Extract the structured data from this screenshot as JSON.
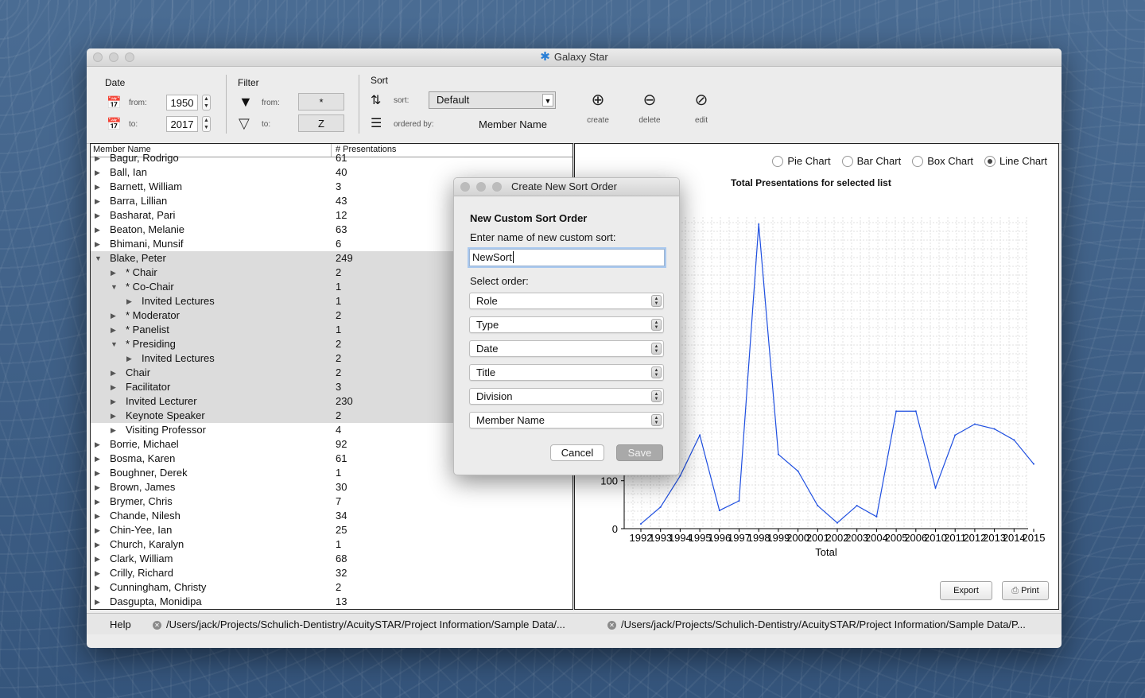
{
  "window": {
    "title": "Galaxy Star",
    "icon": "star-icon"
  },
  "toolbar": {
    "date": {
      "label": "Date",
      "from_label": "from:",
      "to_label": "to:",
      "from_value": "1950",
      "to_value": "2017"
    },
    "filter": {
      "label": "Filter",
      "from_label": "from:",
      "to_label": "to:",
      "from_value": "*",
      "to_value": "Z"
    },
    "sort": {
      "label": "Sort",
      "sort_label": "sort:",
      "sort_value": "Default",
      "ordered_label": "ordered by:",
      "ordered_value": "Member Name"
    },
    "actions": [
      {
        "label": "create",
        "icon": "⊕"
      },
      {
        "label": "delete",
        "icon": "⊖"
      },
      {
        "label": "edit",
        "icon": "⊘"
      }
    ]
  },
  "list": {
    "col_name": "Member Name",
    "col_count": "# Presentations",
    "rows": [
      {
        "name": "Bagur, Rodrigo",
        "count": "61",
        "level": 0,
        "expanded": false,
        "selected": false
      },
      {
        "name": "Ball, Ian",
        "count": "40",
        "level": 0,
        "expanded": false,
        "selected": false
      },
      {
        "name": "Barnett, William",
        "count": "3",
        "level": 0,
        "expanded": false,
        "selected": false
      },
      {
        "name": "Barra, Lillian",
        "count": "43",
        "level": 0,
        "expanded": false,
        "selected": false
      },
      {
        "name": "Basharat, Pari",
        "count": "12",
        "level": 0,
        "expanded": false,
        "selected": false
      },
      {
        "name": "Beaton, Melanie",
        "count": "63",
        "level": 0,
        "expanded": false,
        "selected": false
      },
      {
        "name": "Bhimani, Munsif",
        "count": "6",
        "level": 0,
        "expanded": false,
        "selected": false
      },
      {
        "name": "Blake, Peter",
        "count": "249",
        "level": 0,
        "expanded": true,
        "selected": true
      },
      {
        "name": "* Chair",
        "count": "2",
        "level": 1,
        "expanded": false,
        "selected": true
      },
      {
        "name": "* Co-Chair",
        "count": "1",
        "level": 1,
        "expanded": true,
        "selected": true
      },
      {
        "name": "Invited Lectures",
        "count": "1",
        "level": 2,
        "expanded": false,
        "selected": true
      },
      {
        "name": "* Moderator",
        "count": "2",
        "level": 1,
        "expanded": false,
        "selected": true
      },
      {
        "name": "* Panelist",
        "count": "1",
        "level": 1,
        "expanded": false,
        "selected": true
      },
      {
        "name": "* Presiding",
        "count": "2",
        "level": 1,
        "expanded": true,
        "selected": true
      },
      {
        "name": "Invited Lectures",
        "count": "2",
        "level": 2,
        "expanded": false,
        "selected": true
      },
      {
        "name": "Chair",
        "count": "2",
        "level": 1,
        "expanded": false,
        "selected": true
      },
      {
        "name": "Facilitator",
        "count": "3",
        "level": 1,
        "expanded": false,
        "selected": true
      },
      {
        "name": "Invited Lecturer",
        "count": "230",
        "level": 1,
        "expanded": false,
        "selected": true
      },
      {
        "name": "Keynote Speaker",
        "count": "2",
        "level": 1,
        "expanded": false,
        "selected": true
      },
      {
        "name": "Visiting Professor",
        "count": "4",
        "level": 1,
        "expanded": false,
        "selected": false
      },
      {
        "name": "Borrie, Michael",
        "count": "92",
        "level": 0,
        "expanded": false,
        "selected": false
      },
      {
        "name": "Bosma, Karen",
        "count": "61",
        "level": 0,
        "expanded": false,
        "selected": false
      },
      {
        "name": "Boughner, Derek",
        "count": "1",
        "level": 0,
        "expanded": false,
        "selected": false
      },
      {
        "name": "Brown, James",
        "count": "30",
        "level": 0,
        "expanded": false,
        "selected": false
      },
      {
        "name": "Brymer, Chris",
        "count": "7",
        "level": 0,
        "expanded": false,
        "selected": false
      },
      {
        "name": "Chande, Nilesh",
        "count": "34",
        "level": 0,
        "expanded": false,
        "selected": false
      },
      {
        "name": "Chin-Yee, Ian",
        "count": "25",
        "level": 0,
        "expanded": false,
        "selected": false
      },
      {
        "name": "Church, Karalyn",
        "count": "1",
        "level": 0,
        "expanded": false,
        "selected": false
      },
      {
        "name": "Clark, William",
        "count": "68",
        "level": 0,
        "expanded": false,
        "selected": false
      },
      {
        "name": "Crilly, Richard",
        "count": "32",
        "level": 0,
        "expanded": false,
        "selected": false
      },
      {
        "name": "Cunningham, Christy",
        "count": "2",
        "level": 0,
        "expanded": false,
        "selected": false
      },
      {
        "name": "Dasgupta, Monidipa",
        "count": "13",
        "level": 0,
        "expanded": false,
        "selected": false
      }
    ]
  },
  "chart_panel": {
    "radios": [
      {
        "label": "Pie Chart",
        "checked": false
      },
      {
        "label": "Bar Chart",
        "checked": false
      },
      {
        "label": "Box Chart",
        "checked": false
      },
      {
        "label": "Line Chart",
        "checked": true
      }
    ],
    "export_label": "Export",
    "print_label": "Print"
  },
  "chart_data": {
    "type": "line",
    "title": "Total Presentations for selected list",
    "xlabel": "Total",
    "ylabel": "",
    "x": [
      "1992",
      "1993",
      "1994",
      "1995",
      "1996",
      "1997",
      "1998",
      "1999",
      "2000",
      "2001",
      "2002",
      "2003",
      "2004",
      "2005",
      "2006",
      "2010",
      "2011",
      "2012",
      "2013",
      "2014",
      "2015"
    ],
    "series": [
      {
        "values": [
          10,
          45,
          110,
          195,
          38,
          58,
          635,
          155,
          120,
          48,
          12,
          48,
          25,
          245,
          245,
          85,
          195,
          218,
          208,
          185,
          135
        ],
        "color": "#1f4fe0"
      }
    ],
    "ylim": [
      0,
      650
    ],
    "y_ticks_visible": [
      "0",
      "100"
    ],
    "grid": true
  },
  "statusbar": {
    "help_label": "Help",
    "tabs": [
      "/Users/jack/Projects/Schulich-Dentistry/AcuitySTAR/Project Information/Sample Data/...",
      "/Users/jack/Projects/Schulich-Dentistry/AcuitySTAR/Project Information/Sample Data/P..."
    ]
  },
  "dialog": {
    "title": "Create New Sort Order",
    "heading": "New Custom Sort Order",
    "name_prompt": "Enter name of new custom sort:",
    "name_value": "NewSort",
    "order_label": "Select order:",
    "orders": [
      "Role",
      "Type",
      "Date",
      "Title",
      "Division",
      "Member Name"
    ],
    "cancel_label": "Cancel",
    "save_label": "Save"
  }
}
